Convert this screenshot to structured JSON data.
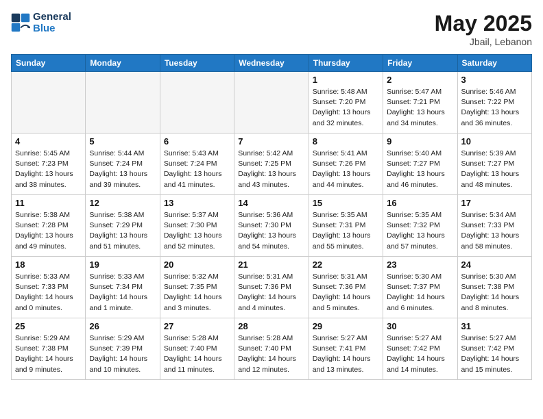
{
  "header": {
    "logo_line1": "General",
    "logo_line2": "Blue",
    "month_year": "May 2025",
    "location": "Jbail, Lebanon"
  },
  "weekdays": [
    "Sunday",
    "Monday",
    "Tuesday",
    "Wednesday",
    "Thursday",
    "Friday",
    "Saturday"
  ],
  "weeks": [
    [
      {
        "day": "",
        "info": ""
      },
      {
        "day": "",
        "info": ""
      },
      {
        "day": "",
        "info": ""
      },
      {
        "day": "",
        "info": ""
      },
      {
        "day": "1",
        "info": "Sunrise: 5:48 AM\nSunset: 7:20 PM\nDaylight: 13 hours\nand 32 minutes."
      },
      {
        "day": "2",
        "info": "Sunrise: 5:47 AM\nSunset: 7:21 PM\nDaylight: 13 hours\nand 34 minutes."
      },
      {
        "day": "3",
        "info": "Sunrise: 5:46 AM\nSunset: 7:22 PM\nDaylight: 13 hours\nand 36 minutes."
      }
    ],
    [
      {
        "day": "4",
        "info": "Sunrise: 5:45 AM\nSunset: 7:23 PM\nDaylight: 13 hours\nand 38 minutes."
      },
      {
        "day": "5",
        "info": "Sunrise: 5:44 AM\nSunset: 7:24 PM\nDaylight: 13 hours\nand 39 minutes."
      },
      {
        "day": "6",
        "info": "Sunrise: 5:43 AM\nSunset: 7:24 PM\nDaylight: 13 hours\nand 41 minutes."
      },
      {
        "day": "7",
        "info": "Sunrise: 5:42 AM\nSunset: 7:25 PM\nDaylight: 13 hours\nand 43 minutes."
      },
      {
        "day": "8",
        "info": "Sunrise: 5:41 AM\nSunset: 7:26 PM\nDaylight: 13 hours\nand 44 minutes."
      },
      {
        "day": "9",
        "info": "Sunrise: 5:40 AM\nSunset: 7:27 PM\nDaylight: 13 hours\nand 46 minutes."
      },
      {
        "day": "10",
        "info": "Sunrise: 5:39 AM\nSunset: 7:27 PM\nDaylight: 13 hours\nand 48 minutes."
      }
    ],
    [
      {
        "day": "11",
        "info": "Sunrise: 5:38 AM\nSunset: 7:28 PM\nDaylight: 13 hours\nand 49 minutes."
      },
      {
        "day": "12",
        "info": "Sunrise: 5:38 AM\nSunset: 7:29 PM\nDaylight: 13 hours\nand 51 minutes."
      },
      {
        "day": "13",
        "info": "Sunrise: 5:37 AM\nSunset: 7:30 PM\nDaylight: 13 hours\nand 52 minutes."
      },
      {
        "day": "14",
        "info": "Sunrise: 5:36 AM\nSunset: 7:30 PM\nDaylight: 13 hours\nand 54 minutes."
      },
      {
        "day": "15",
        "info": "Sunrise: 5:35 AM\nSunset: 7:31 PM\nDaylight: 13 hours\nand 55 minutes."
      },
      {
        "day": "16",
        "info": "Sunrise: 5:35 AM\nSunset: 7:32 PM\nDaylight: 13 hours\nand 57 minutes."
      },
      {
        "day": "17",
        "info": "Sunrise: 5:34 AM\nSunset: 7:33 PM\nDaylight: 13 hours\nand 58 minutes."
      }
    ],
    [
      {
        "day": "18",
        "info": "Sunrise: 5:33 AM\nSunset: 7:33 PM\nDaylight: 14 hours\nand 0 minutes."
      },
      {
        "day": "19",
        "info": "Sunrise: 5:33 AM\nSunset: 7:34 PM\nDaylight: 14 hours\nand 1 minute."
      },
      {
        "day": "20",
        "info": "Sunrise: 5:32 AM\nSunset: 7:35 PM\nDaylight: 14 hours\nand 3 minutes."
      },
      {
        "day": "21",
        "info": "Sunrise: 5:31 AM\nSunset: 7:36 PM\nDaylight: 14 hours\nand 4 minutes."
      },
      {
        "day": "22",
        "info": "Sunrise: 5:31 AM\nSunset: 7:36 PM\nDaylight: 14 hours\nand 5 minutes."
      },
      {
        "day": "23",
        "info": "Sunrise: 5:30 AM\nSunset: 7:37 PM\nDaylight: 14 hours\nand 6 minutes."
      },
      {
        "day": "24",
        "info": "Sunrise: 5:30 AM\nSunset: 7:38 PM\nDaylight: 14 hours\nand 8 minutes."
      }
    ],
    [
      {
        "day": "25",
        "info": "Sunrise: 5:29 AM\nSunset: 7:38 PM\nDaylight: 14 hours\nand 9 minutes."
      },
      {
        "day": "26",
        "info": "Sunrise: 5:29 AM\nSunset: 7:39 PM\nDaylight: 14 hours\nand 10 minutes."
      },
      {
        "day": "27",
        "info": "Sunrise: 5:28 AM\nSunset: 7:40 PM\nDaylight: 14 hours\nand 11 minutes."
      },
      {
        "day": "28",
        "info": "Sunrise: 5:28 AM\nSunset: 7:40 PM\nDaylight: 14 hours\nand 12 minutes."
      },
      {
        "day": "29",
        "info": "Sunrise: 5:27 AM\nSunset: 7:41 PM\nDaylight: 14 hours\nand 13 minutes."
      },
      {
        "day": "30",
        "info": "Sunrise: 5:27 AM\nSunset: 7:42 PM\nDaylight: 14 hours\nand 14 minutes."
      },
      {
        "day": "31",
        "info": "Sunrise: 5:27 AM\nSunset: 7:42 PM\nDaylight: 14 hours\nand 15 minutes."
      }
    ]
  ]
}
